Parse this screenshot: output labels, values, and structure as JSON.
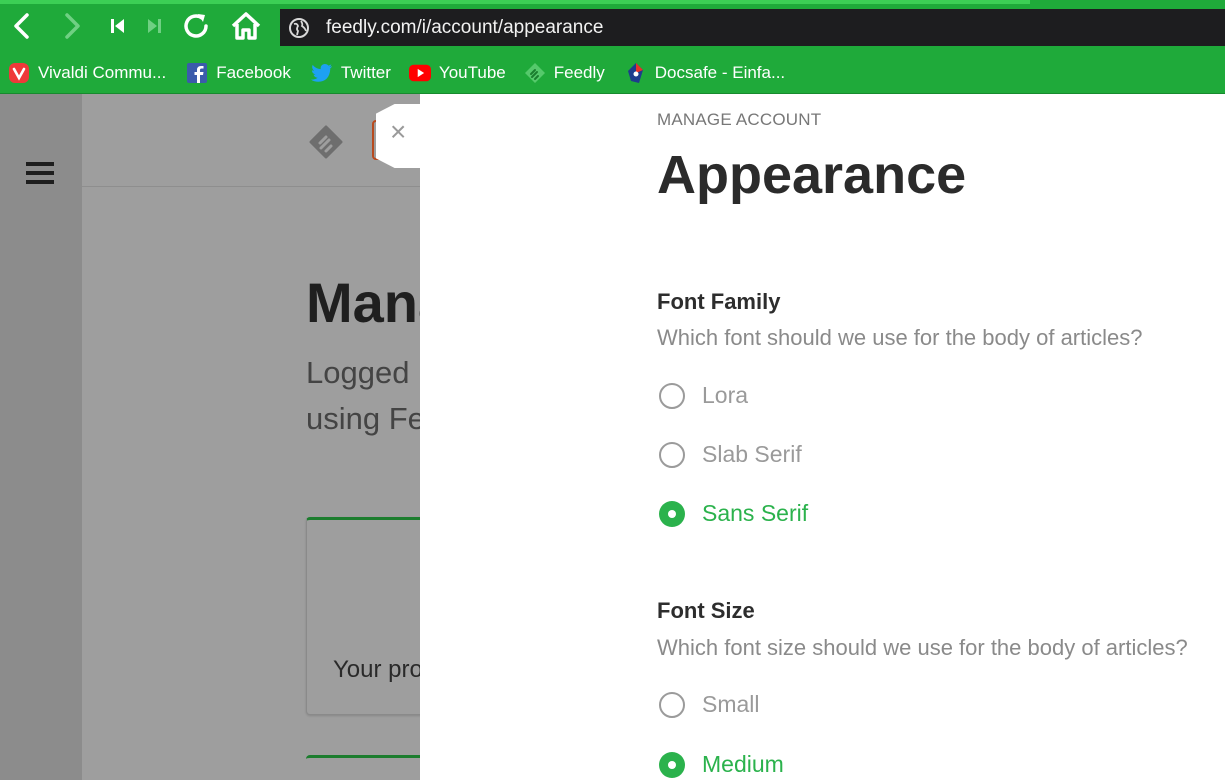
{
  "browser": {
    "url": "feedly.com/i/account/appearance",
    "accent": "#1faa3a",
    "bookmarks": [
      {
        "label": "Vivaldi Commu...",
        "icon": "vivaldi-icon"
      },
      {
        "label": "Facebook",
        "icon": "facebook-icon"
      },
      {
        "label": "Twitter",
        "icon": "twitter-icon"
      },
      {
        "label": "YouTube",
        "icon": "youtube-icon"
      },
      {
        "label": "Feedly",
        "icon": "feedly-icon"
      },
      {
        "label": "Docsafe - Einfa...",
        "icon": "docsafe-icon"
      }
    ]
  },
  "background_page": {
    "title": "Mana",
    "subtitle_line1": "Logged",
    "subtitle_line2": "using Fe",
    "card_text": "Your pro"
  },
  "panel": {
    "close_symbol": "×",
    "eyebrow": "MANAGE ACCOUNT",
    "title": "Appearance",
    "accent": "#2bb24c",
    "font_family": {
      "title": "Font Family",
      "description": "Which font should we use for the body of articles?",
      "options": [
        {
          "label": "Lora",
          "selected": false
        },
        {
          "label": "Slab Serif",
          "selected": false
        },
        {
          "label": "Sans Serif",
          "selected": true
        }
      ]
    },
    "font_size": {
      "title": "Font Size",
      "description": "Which font size should we use for the body of articles?",
      "options": [
        {
          "label": "Small",
          "selected": false
        },
        {
          "label": "Medium",
          "selected": true
        }
      ]
    }
  }
}
